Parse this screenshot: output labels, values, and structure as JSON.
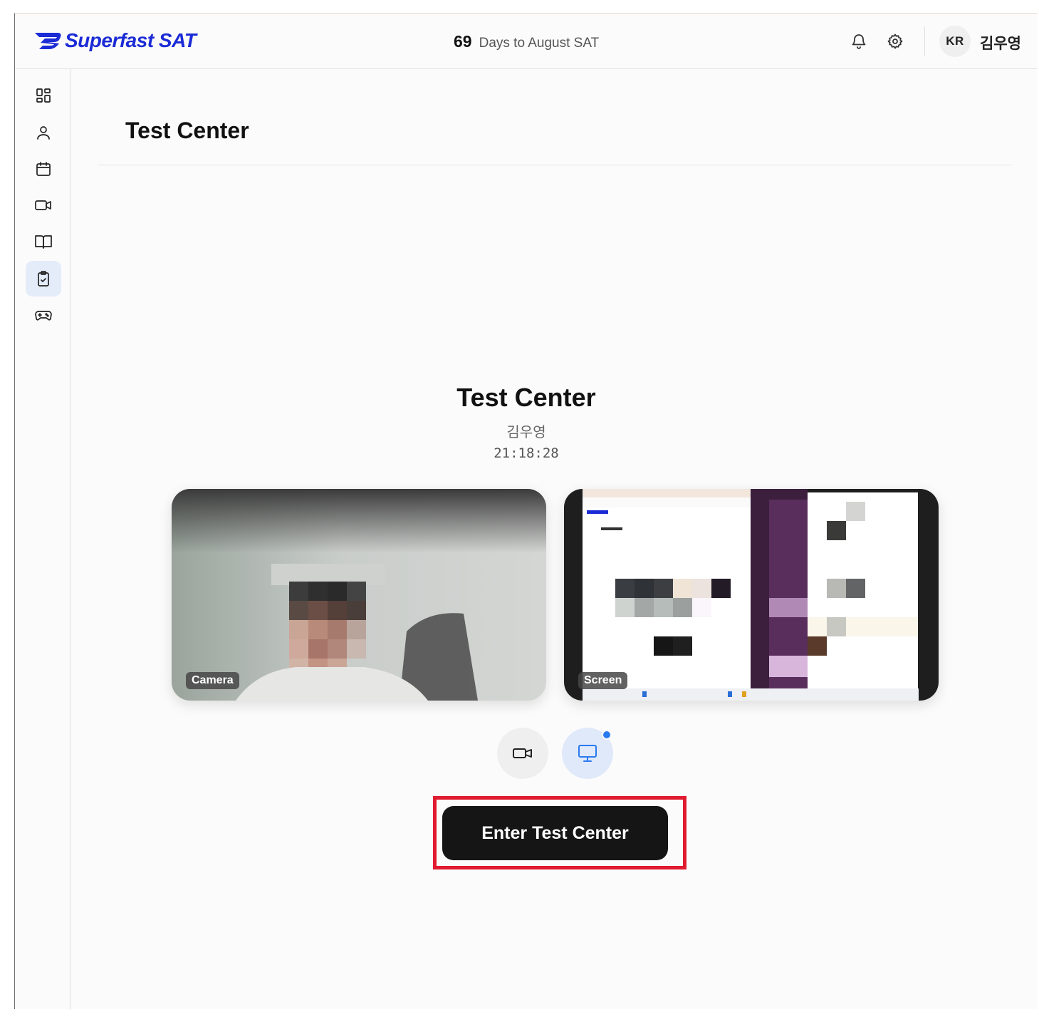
{
  "header": {
    "logo_text": "Superfast SAT",
    "days_number": "69",
    "days_text": "Days to August SAT",
    "language_badge": "KR",
    "user_name": "김우영",
    "icons": [
      "bell-icon",
      "gear-icon"
    ]
  },
  "sidebar": {
    "items": [
      {
        "icon": "dashboard-icon",
        "active": false
      },
      {
        "icon": "user-icon",
        "active": false
      },
      {
        "icon": "calendar-icon",
        "active": false
      },
      {
        "icon": "video-icon",
        "active": false
      },
      {
        "icon": "book-icon",
        "active": false
      },
      {
        "icon": "clipboard-check-icon",
        "active": true
      },
      {
        "icon": "gamepad-icon",
        "active": false
      }
    ]
  },
  "main": {
    "page_title": "Test Center",
    "panel_title": "Test Center",
    "student_name": "김우영",
    "clock": "21:18:28",
    "feeds": {
      "camera_label": "Camera",
      "screen_label": "Screen"
    },
    "controls": {
      "camera_toggle": "video-icon",
      "screen_toggle": "monitor-icon",
      "screen_active": true
    },
    "enter_button": "Enter Test Center"
  },
  "colors": {
    "brand": "#1b2bd6",
    "active_nav": "#e4ecf9",
    "highlight_box": "#e01a2f",
    "button_bg": "#151515",
    "status_dot": "#2a7af0"
  }
}
